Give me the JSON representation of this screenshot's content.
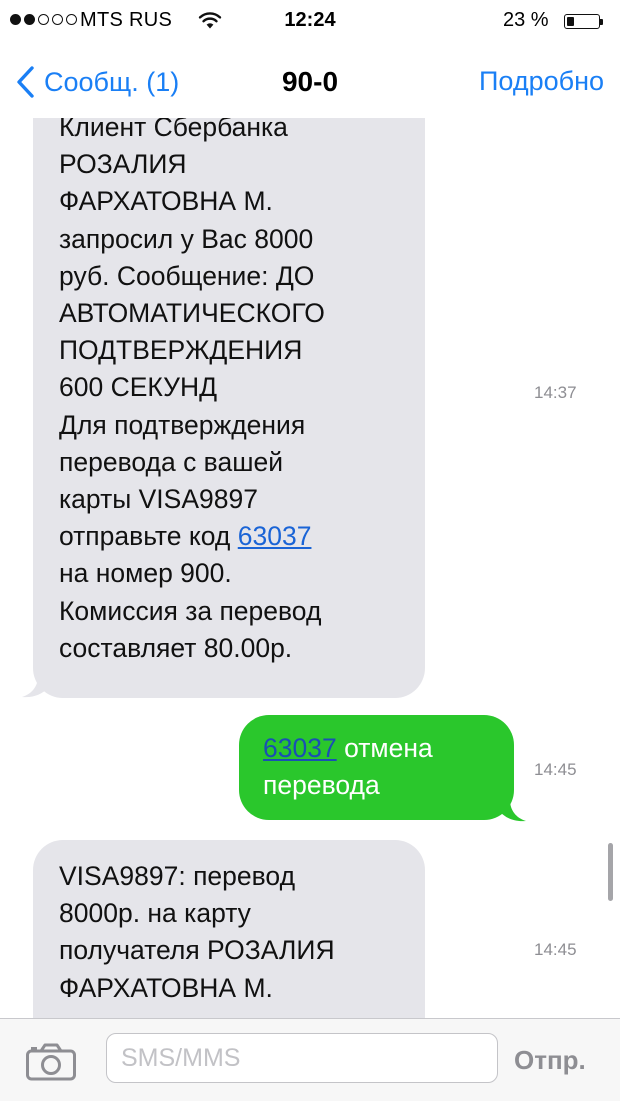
{
  "status_bar": {
    "carrier": "MTS RUS",
    "time": "12:24",
    "battery_percent_text": "23 %",
    "battery_level": 0.23,
    "signal_bars": 2,
    "signal_total": 5
  },
  "nav": {
    "back_label": "Сообщ. (1)",
    "title": "90-0",
    "details_label": "Подробно"
  },
  "messages": [
    {
      "direction": "incoming",
      "text_before": "Клиент Сбербанка\nРОЗАЛИЯ\nФАРХАТОВНА М.\nзапросил у Вас 8000\nруб. Сообщение: ДО\nАВТОМАТИЧЕСКОГО\nПОДТВЕРЖДЕНИЯ\n600 СЕКУНД\nДля подтверждения\nперевода с вашей\nкарты VISA9897\nотправьте код ",
      "code": "63037",
      "text_after": "\nна номер 900.\nКомиссия за перевод\nсоставляет 80.00р.",
      "time": "14:37"
    },
    {
      "direction": "outgoing",
      "code": "63037",
      "text_after": " отмена\nперевода",
      "time": "14:45"
    },
    {
      "direction": "incoming",
      "text": "VISA9897: перевод\n8000р. на карту\nполучателя РОЗАЛИЯ\nФАРХАТОВНА М.",
      "time": "14:45"
    }
  ],
  "composer": {
    "placeholder": "SMS/MMS",
    "send_label": "Отпр."
  },
  "colors": {
    "accent": "#1a7ff5",
    "incoming_bubble": "#e5e5ea",
    "outgoing_bubble": "#2ac72c",
    "link": "#1a64d6",
    "timestamp": "#8e8e93"
  },
  "icons": {
    "back": "chevron-left-icon",
    "wifi": "wifi-icon",
    "battery": "battery-icon",
    "camera": "camera-icon"
  }
}
